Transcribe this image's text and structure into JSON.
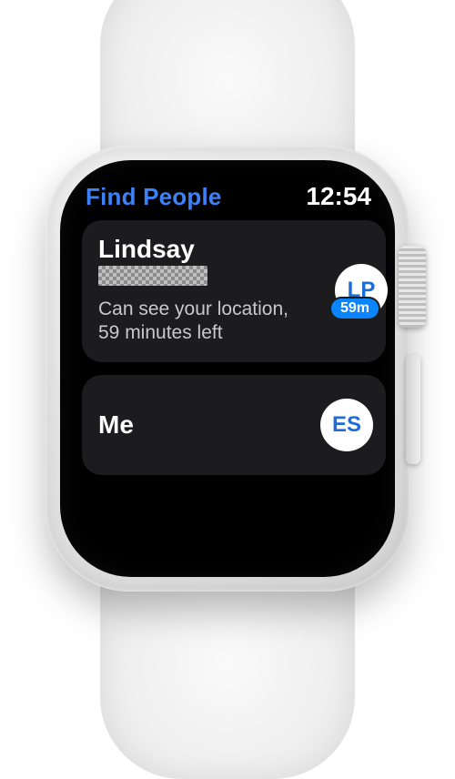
{
  "status_bar": {
    "app_title": "Find People",
    "time": "12:54"
  },
  "people": [
    {
      "name": "Lindsay",
      "subtitle": "Can see your location, 59 minutes left",
      "avatar_initials": "LP",
      "distance_badge": "59m"
    }
  ],
  "me_row": {
    "label": "Me",
    "avatar_initials": "ES"
  },
  "colors": {
    "accent_blue": "#3b82f6",
    "badge_blue": "#0a84ff",
    "row_bg": "#1c1c1e"
  }
}
